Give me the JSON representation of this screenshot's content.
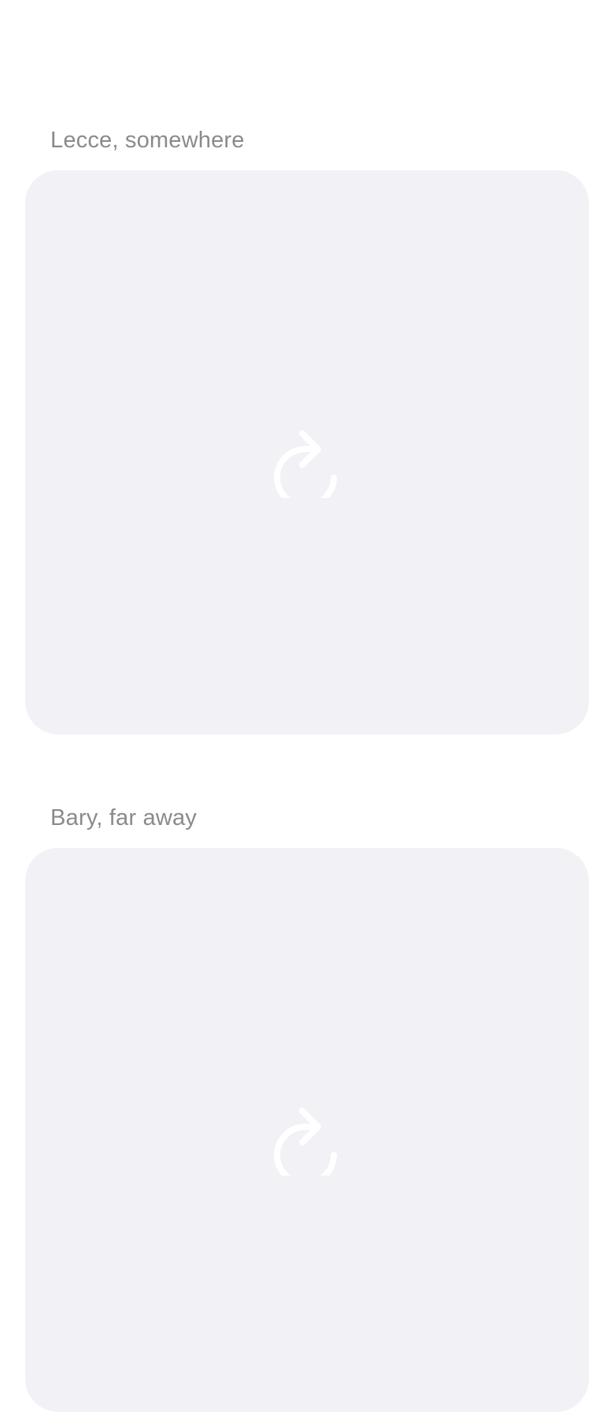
{
  "items": [
    {
      "label": "Lecce, somewhere",
      "media": {
        "state": "reload",
        "icon": "reload-icon",
        "background": "#f1f1f6",
        "icon_color": "#ffffff"
      }
    },
    {
      "label": "Bary, far away",
      "media": {
        "state": "reload",
        "icon": "reload-icon",
        "background": "#f1f1f6",
        "icon_color": "#ffffff"
      }
    }
  ],
  "colors": {
    "page_background": "#ffffff",
    "label_text": "#8a8a8e"
  }
}
